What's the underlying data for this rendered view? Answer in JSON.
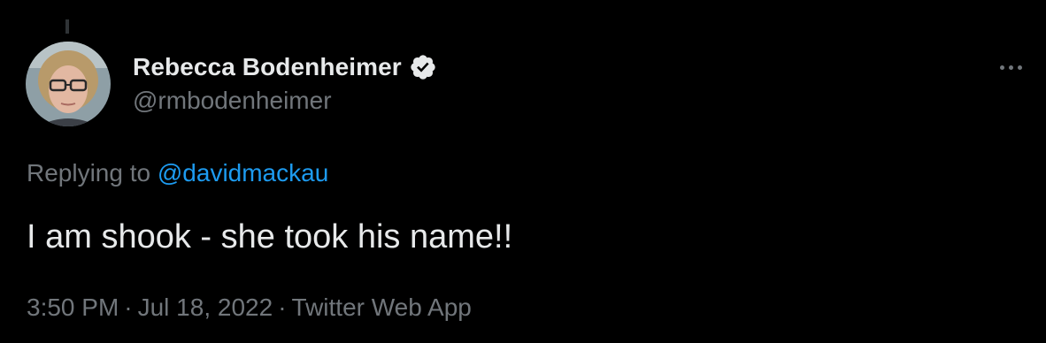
{
  "tweet": {
    "author": {
      "display_name": "Rebecca Bodenheimer",
      "handle": "@rmbodenheimer",
      "verified_icon": "verified-badge-icon"
    },
    "reply": {
      "prefix": "Replying to",
      "mention": "@davidmackau"
    },
    "text": "I am shook - she took his name!!",
    "meta": {
      "time": "3:50 PM",
      "separator": "·",
      "date": "Jul 18, 2022",
      "source": "Twitter Web App"
    },
    "more_icon": "more-horizontal-icon"
  },
  "colors": {
    "background": "#000000",
    "primary_text": "#e7e9ea",
    "secondary_text": "#71767b",
    "link": "#1d9bf0"
  }
}
